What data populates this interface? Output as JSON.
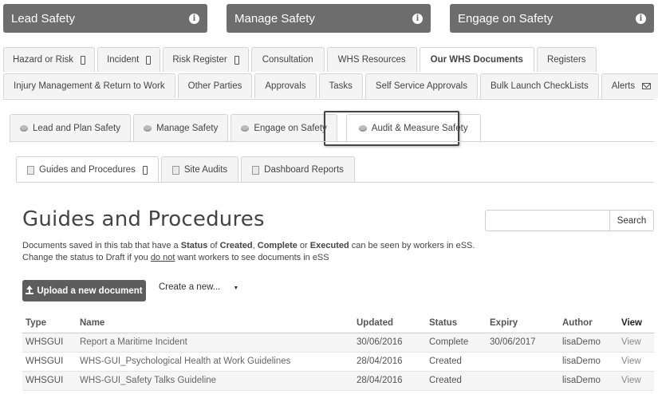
{
  "banners": [
    {
      "label": "Lead Safety"
    },
    {
      "label": "Manage Safety"
    },
    {
      "label": "Engage on Safety"
    }
  ],
  "info_glyph": "i",
  "nav_row1": [
    {
      "label": "Hazard or Risk",
      "icon": "phone-icon"
    },
    {
      "label": "Incident",
      "icon": "phone-icon"
    },
    {
      "label": "Risk Register",
      "icon": "phone-icon"
    },
    {
      "label": "Consultation"
    },
    {
      "label": "WHS Resources"
    },
    {
      "label": "Our WHS Documents",
      "active": true
    },
    {
      "label": "Registers"
    }
  ],
  "nav_row2": [
    {
      "label": "Injury Management & Return to Work"
    },
    {
      "label": "Other Parties"
    },
    {
      "label": "Approvals"
    },
    {
      "label": "Tasks"
    },
    {
      "label": "Self Service Approvals"
    },
    {
      "label": "Bulk Launch CheckLists"
    },
    {
      "label": "Alerts",
      "icon": "mail-icon"
    }
  ],
  "category_tabs": [
    {
      "label": "Lead and Plan Safety"
    },
    {
      "label": "Manage Safety"
    },
    {
      "label": "Engage on Safety"
    },
    {
      "label": "Audit & Measure Safety",
      "active": true
    }
  ],
  "sub_tabs": [
    {
      "label": "Guides and Procedures",
      "active": true,
      "icon": "phone-icon"
    },
    {
      "label": "Site Audits"
    },
    {
      "label": "Dashboard Reports"
    }
  ],
  "page": {
    "title": "Guides and Procedures",
    "search_button": "Search",
    "search_placeholder": "",
    "note_line1": {
      "t1": "Documents saved in this tab that have a ",
      "b1": "Status",
      "t2": " of ",
      "b2": "Created",
      "t3": ", ",
      "b3": "Complete",
      "t4": " or ",
      "b4": "Executed",
      "t5": " can be seen by workers in eSS."
    },
    "note_line2": {
      "t1": "Change the status to Draft if you ",
      "u1": "do not",
      "t2": " want workers to see documents in eSS"
    },
    "upload_button": "Upload a new document",
    "create_new": "Create a new...",
    "caret": "▼"
  },
  "table": {
    "columns": [
      "Type",
      "Name",
      "Updated",
      "Status",
      "Expiry",
      "Author",
      "View"
    ],
    "rows": [
      {
        "type": "WHSGUI",
        "name": "Report a Maritime Incident",
        "updated": "30/06/2016",
        "status": "Complete",
        "expiry": "30/06/2017",
        "author": "lisaDemo",
        "view": "View"
      },
      {
        "type": "WHSGUI",
        "name": "WHS-GUI_Psychological Health at Work Guidelines",
        "updated": "28/04/2016",
        "status": "Created",
        "expiry": "",
        "author": "lisaDemo",
        "view": "View"
      },
      {
        "type": "WHSGUI",
        "name": "WHS-GUI_Safety Talks Guideline",
        "updated": "28/04/2016",
        "status": "Created",
        "expiry": "",
        "author": "lisaDemo",
        "view": "View"
      }
    ]
  }
}
